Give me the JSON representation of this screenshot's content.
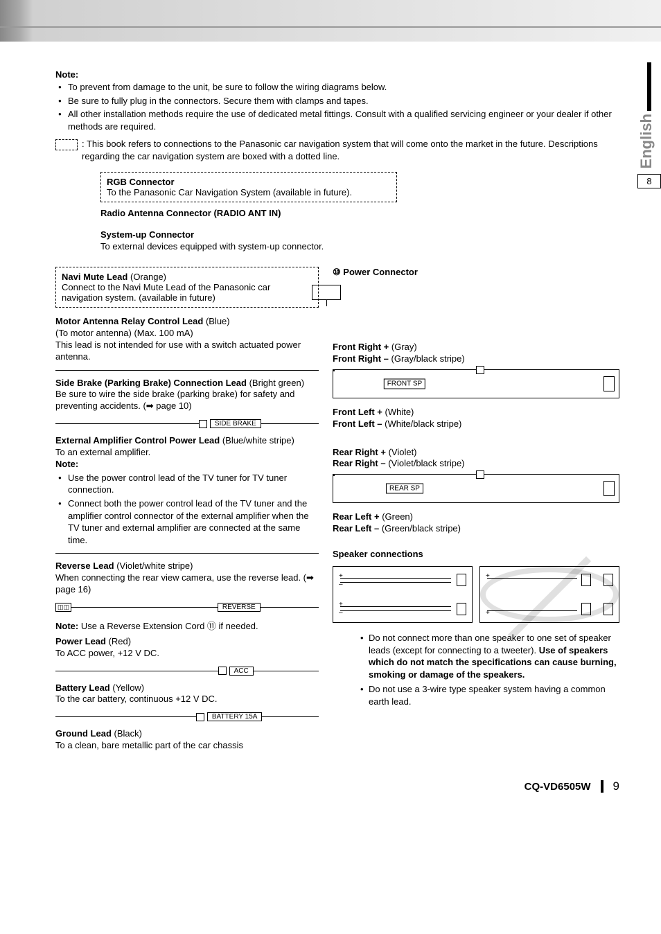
{
  "side": {
    "language": "English",
    "page_tab": "8"
  },
  "notes": {
    "heading": "Note:",
    "items": [
      "To prevent from damage to the unit, be sure to follow the wiring diagrams below.",
      "Be sure to fully plug in the connectors. Secure them with clamps and tapes.",
      "All other installation methods require the use of dedicated metal fittings. Consult with a qualified servicing engineer or your dealer if other methods are required."
    ],
    "dotted_info": ": This book refers to connections to the Panasonic car navigation system that will come onto the market in the future. Descriptions regarding the car navigation system are boxed with a dotted line."
  },
  "connectors": {
    "rgb": {
      "title": "RGB Connector",
      "desc": "To the Panasonic Car Navigation System (available in future)."
    },
    "radio": {
      "title": "Radio Antenna Connector (RADIO ANT IN)"
    },
    "systemup": {
      "title": "System-up Connector",
      "desc": "To external devices equipped with system-up connector."
    },
    "power": {
      "num": "⑩",
      "title": "Power Connector"
    }
  },
  "leads": {
    "navi_mute": {
      "title": "Navi Mute Lead",
      "color": "(Orange)",
      "desc": "Connect to the Navi Mute Lead of the Panasonic car navigation system. (available in future)"
    },
    "motor_ant": {
      "title": "Motor Antenna Relay Control Lead",
      "color": "(Blue)",
      "l1": "(To motor antenna) (Max. 100 mA)",
      "l2": "This lead is not intended for use with a switch actuated power antenna."
    },
    "side_brake": {
      "title": "Side Brake (Parking Brake) Connection Lead",
      "color": "(Bright green)",
      "desc": "Be sure to wire the side brake (parking brake) for safety and preventing accidents. (➡ page 10)",
      "tag": "SIDE BRAKE"
    },
    "ext_amp": {
      "title": "External Amplifier Control Power Lead",
      "color": "(Blue/white stripe)",
      "desc": "To an external amplifier.",
      "note_heading": "Note:",
      "notes": [
        "Use the power control lead of the TV tuner for TV tuner connection.",
        "Connect both the power control lead of the TV tuner and the amplifier control connector of the external amplifier when the TV tuner and external amplifier are connected at the same time."
      ]
    },
    "reverse": {
      "title": "Reverse Lead",
      "color": "(Violet/white stripe)",
      "desc": "When connecting the rear view camera, use the reverse lead. (➡ page 16)",
      "tag": "REVERSE",
      "note": "Use a Reverse Extension Cord ⑪ if needed.",
      "note_label": "Note:"
    },
    "power": {
      "title": "Power Lead",
      "color": "(Red)",
      "desc": "To ACC power, +12 V DC.",
      "tag": "ACC"
    },
    "battery": {
      "title": "Battery Lead",
      "color": "(Yellow)",
      "desc": "To the car battery, continuous +12 V DC.",
      "tag": "BATTERY 15A"
    },
    "ground": {
      "title": "Ground Lead",
      "color": "(Black)",
      "desc": "To a clean, bare metallic part of the car chassis"
    }
  },
  "speakers": {
    "fr": {
      "plus": "Front Right +",
      "plus_c": "(Gray)",
      "minus": "Front Right –",
      "minus_c": "(Gray/black stripe)",
      "tag": "FRONT SP"
    },
    "fl": {
      "plus": "Front Left +",
      "plus_c": "(White)",
      "minus": "Front Left –",
      "minus_c": "(White/black stripe)"
    },
    "rr": {
      "plus": "Rear Right +",
      "plus_c": "(Violet)",
      "minus": "Rear Right –",
      "minus_c": "(Violet/black stripe)",
      "tag": "REAR SP"
    },
    "rl": {
      "plus": "Rear Left +",
      "plus_c": "(Green)",
      "minus": "Rear Left –",
      "minus_c": "(Green/black stripe)"
    }
  },
  "speaker_connections": {
    "title": "Speaker connections",
    "notes": [
      {
        "pre": "Do not connect more than one speaker to one set of speaker leads (except for connecting to a tweeter). ",
        "bold": "Use of speakers which do not match the specifications can cause burning, smoking or damage of the speakers."
      },
      {
        "pre": "Do not use a 3-wire type speaker system having a common earth lead.",
        "bold": ""
      }
    ]
  },
  "footer": {
    "model": "CQ-VD6505W",
    "page": "9"
  }
}
